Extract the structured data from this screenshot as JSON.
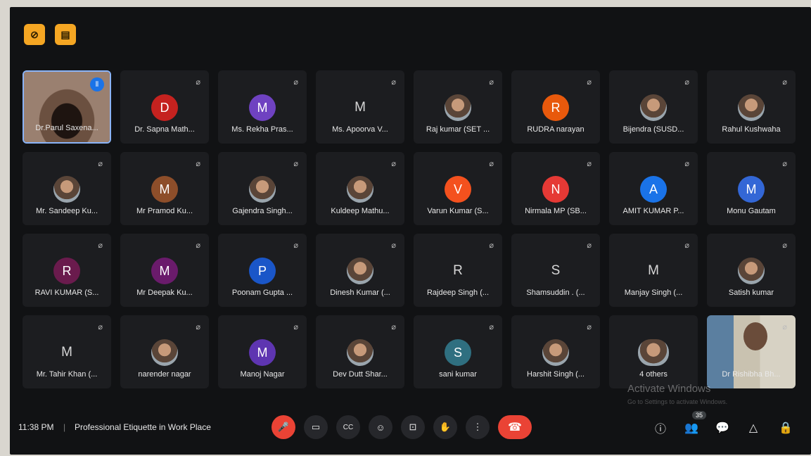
{
  "top_icons": [
    "camera-off-icon",
    "room-icon"
  ],
  "participants": [
    {
      "name": "Dr.Parul Saxena...",
      "initial": "",
      "color": "",
      "kind": "video",
      "speaking": true
    },
    {
      "name": "Dr. Sapna Math...",
      "initial": "D",
      "color": "#c5221f",
      "kind": "initial"
    },
    {
      "name": "Ms. Rekha Pras...",
      "initial": "M",
      "color": "#6f42c1",
      "kind": "initial"
    },
    {
      "name": "Ms. Apoorva V...",
      "initial": "M",
      "color": "",
      "kind": "plain"
    },
    {
      "name": "Raj kumar (SET ...",
      "initial": "",
      "color": "",
      "kind": "photo"
    },
    {
      "name": "RUDRA narayan",
      "initial": "R",
      "color": "#e8590c",
      "kind": "initial"
    },
    {
      "name": "Bijendra (SUSD...",
      "initial": "",
      "color": "",
      "kind": "photo"
    },
    {
      "name": "Rahul Kushwaha",
      "initial": "",
      "color": "",
      "kind": "photo"
    },
    {
      "name": "Mr. Sandeep Ku...",
      "initial": "",
      "color": "",
      "kind": "photo"
    },
    {
      "name": "Mr Pramod Ku...",
      "initial": "M",
      "color": "#8d4e2a",
      "kind": "initial"
    },
    {
      "name": "Gajendra Singh...",
      "initial": "",
      "color": "",
      "kind": "photo"
    },
    {
      "name": "Kuldeep Mathu...",
      "initial": "",
      "color": "",
      "kind": "photo"
    },
    {
      "name": "Varun Kumar (S...",
      "initial": "V",
      "color": "#f4511e",
      "kind": "initial"
    },
    {
      "name": "Nirmala MP (SB...",
      "initial": "N",
      "color": "#e53935",
      "kind": "initial"
    },
    {
      "name": "AMIT KUMAR P...",
      "initial": "A",
      "color": "#1a73e8",
      "kind": "initial"
    },
    {
      "name": "Monu Gautam",
      "initial": "M",
      "color": "#3367d6",
      "kind": "initial"
    },
    {
      "name": "RAVI KUMAR (S...",
      "initial": "R",
      "color": "#6a1b4d",
      "kind": "initial"
    },
    {
      "name": "Mr Deepak Ku...",
      "initial": "M",
      "color": "#6a1b6b",
      "kind": "initial"
    },
    {
      "name": "Poonam Gupta ...",
      "initial": "P",
      "color": "#1a56c8",
      "kind": "initial"
    },
    {
      "name": "Dinesh Kumar (...",
      "initial": "",
      "color": "",
      "kind": "photo"
    },
    {
      "name": "Rajdeep Singh (...",
      "initial": "R",
      "color": "",
      "kind": "plain"
    },
    {
      "name": "Shamsuddin . (...",
      "initial": "S",
      "color": "",
      "kind": "plain"
    },
    {
      "name": "Manjay Singh (...",
      "initial": "M",
      "color": "",
      "kind": "plain"
    },
    {
      "name": "Satish kumar",
      "initial": "",
      "color": "",
      "kind": "photo"
    },
    {
      "name": "Mr. Tahir Khan (...",
      "initial": "M",
      "color": "",
      "kind": "plain"
    },
    {
      "name": "narender nagar",
      "initial": "",
      "color": "",
      "kind": "photo"
    },
    {
      "name": "Manoj Nagar",
      "initial": "M",
      "color": "#5e35b1",
      "kind": "initial"
    },
    {
      "name": "Dev Dutt Shar...",
      "initial": "",
      "color": "",
      "kind": "photo"
    },
    {
      "name": "sani kumar",
      "initial": "S",
      "color": "#2f6f80",
      "kind": "initial"
    },
    {
      "name": "Harshit Singh (...",
      "initial": "",
      "color": "",
      "kind": "photo"
    },
    {
      "name": "4 others",
      "initial": "",
      "color": "",
      "kind": "others"
    },
    {
      "name": "Dr Rishibha Bh...",
      "initial": "",
      "color": "",
      "kind": "video2"
    }
  ],
  "watermark": {
    "title": "Activate Windows",
    "subtitle": "Go to Settings to activate Windows."
  },
  "bottom": {
    "time": "11:38 PM",
    "separator": "|",
    "meeting_title": "Professional Etiquette in Work Place",
    "participant_count": "35"
  },
  "controls": {
    "mic": "🎤",
    "camera": "▭",
    "captions": "CC",
    "emoji": "☺",
    "present": "⊡",
    "raise_hand": "✋",
    "more": "⋮",
    "end_call": "☎",
    "info": "ⓘ",
    "people": "👥",
    "chat": "💬",
    "activities": "△",
    "host_controls": "🔒"
  },
  "colors": {
    "background": "#111214",
    "tile": "#1c1d20",
    "accent_red": "#ea4335",
    "accent_yellow": "#f5a623",
    "active_border": "#8ab4f8"
  }
}
